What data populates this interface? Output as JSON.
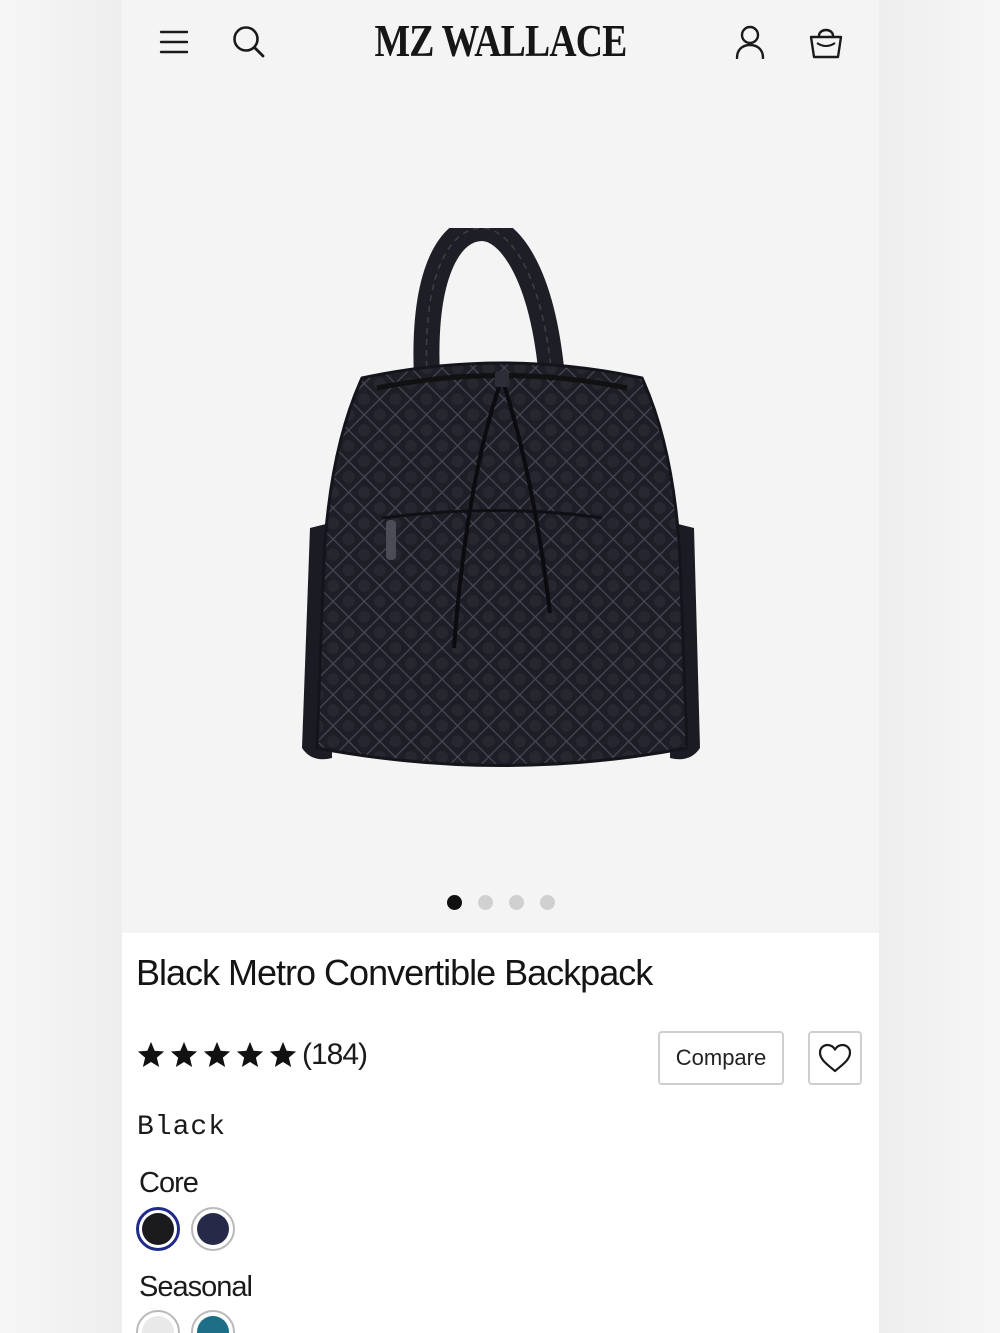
{
  "brand": {
    "logo_text": "MZ WALLACE"
  },
  "header": {
    "icons": [
      "menu-icon",
      "search-icon",
      "account-icon",
      "bag-icon"
    ]
  },
  "gallery": {
    "image_count": 4,
    "active_index": 0
  },
  "product": {
    "title": "Black Metro Convertible Backpack",
    "rating_stars": 5,
    "review_count": "(184)",
    "compare_label": "Compare",
    "selected_color": "Black"
  },
  "swatches": {
    "core": {
      "label": "Core",
      "colors": [
        {
          "hex": "#1b1b1e",
          "selected": true
        },
        {
          "hex": "#262a48",
          "selected": false
        }
      ]
    },
    "seasonal": {
      "label": "Seasonal",
      "colors": [
        {
          "hex": "#e9e9e9",
          "selected": false
        },
        {
          "hex": "#1c6f86",
          "selected": false
        }
      ]
    }
  },
  "colors": {
    "accent_selected": "#1f2a8a",
    "text": "#141414"
  }
}
